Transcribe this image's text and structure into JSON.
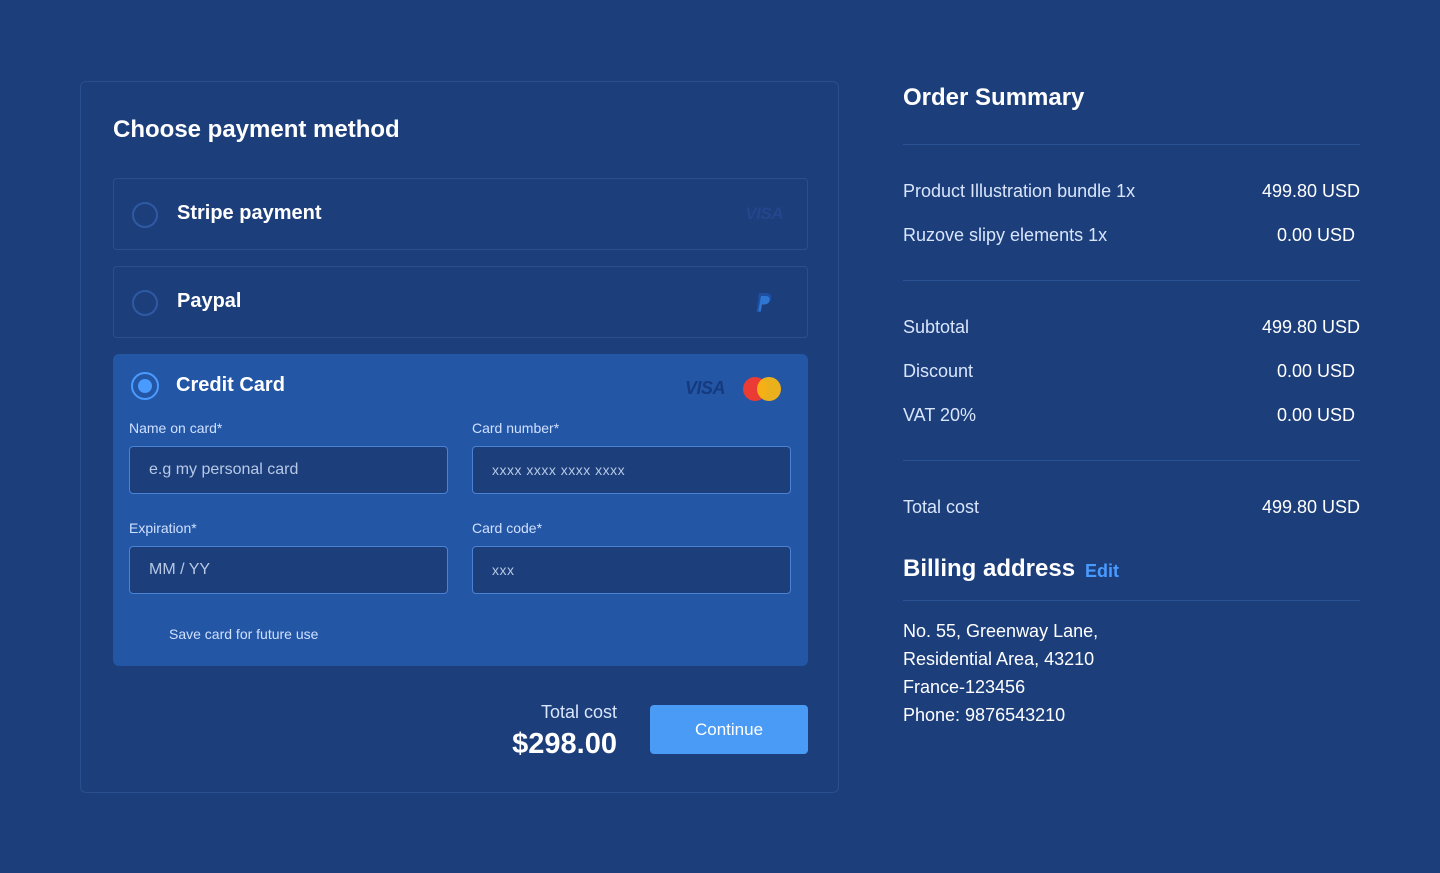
{
  "payment": {
    "title": "Choose payment method",
    "methods": [
      {
        "label": "Stripe payment",
        "logo": "VISA",
        "selected": false
      },
      {
        "label": "Paypal",
        "logo": "paypal-icon",
        "selected": false
      },
      {
        "label": "Credit Card",
        "logo": "VISA",
        "selected": true
      }
    ],
    "fields": {
      "name_label": "Name on card*",
      "name_placeholder": "e.g my personal card",
      "number_label": "Card number*",
      "number_placeholder": "xxxx xxxx xxxx xxxx",
      "expiration_label": "Expiration*",
      "expiration_placeholder": "MM / YY",
      "code_label": "Card code*",
      "code_placeholder": "xxx"
    },
    "save_card_label": "Save card for future use",
    "total_label": "Total cost",
    "total_value": "$298.00",
    "continue_label": "Continue"
  },
  "summary": {
    "title": "Order Summary",
    "items": [
      {
        "label": "Product Illustration bundle 1x",
        "value": "499.80 USD"
      },
      {
        "label": "Ruzove slipy elements 1x",
        "value": "0.00 USD"
      }
    ],
    "subtotal_label": "Subtotal",
    "subtotal_value": "499.80 USD",
    "discount_label": "Discount",
    "discount_value": "0.00 USD",
    "vat_label": "VAT 20%",
    "vat_value": "0.00 USD",
    "total_label": "Total cost",
    "total_value": "499.80 USD"
  },
  "billing": {
    "title": "Billing address",
    "edit_label": "Edit",
    "lines": [
      "No. 55, Greenway Lane,",
      "Residential Area, 43210",
      "France-123456",
      "Phone: 9876543210"
    ]
  },
  "colors": {
    "background": "#1c3f7c",
    "card_selected": "#2456a6",
    "accent": "#4a9bff",
    "button": "#4a9bf5"
  }
}
